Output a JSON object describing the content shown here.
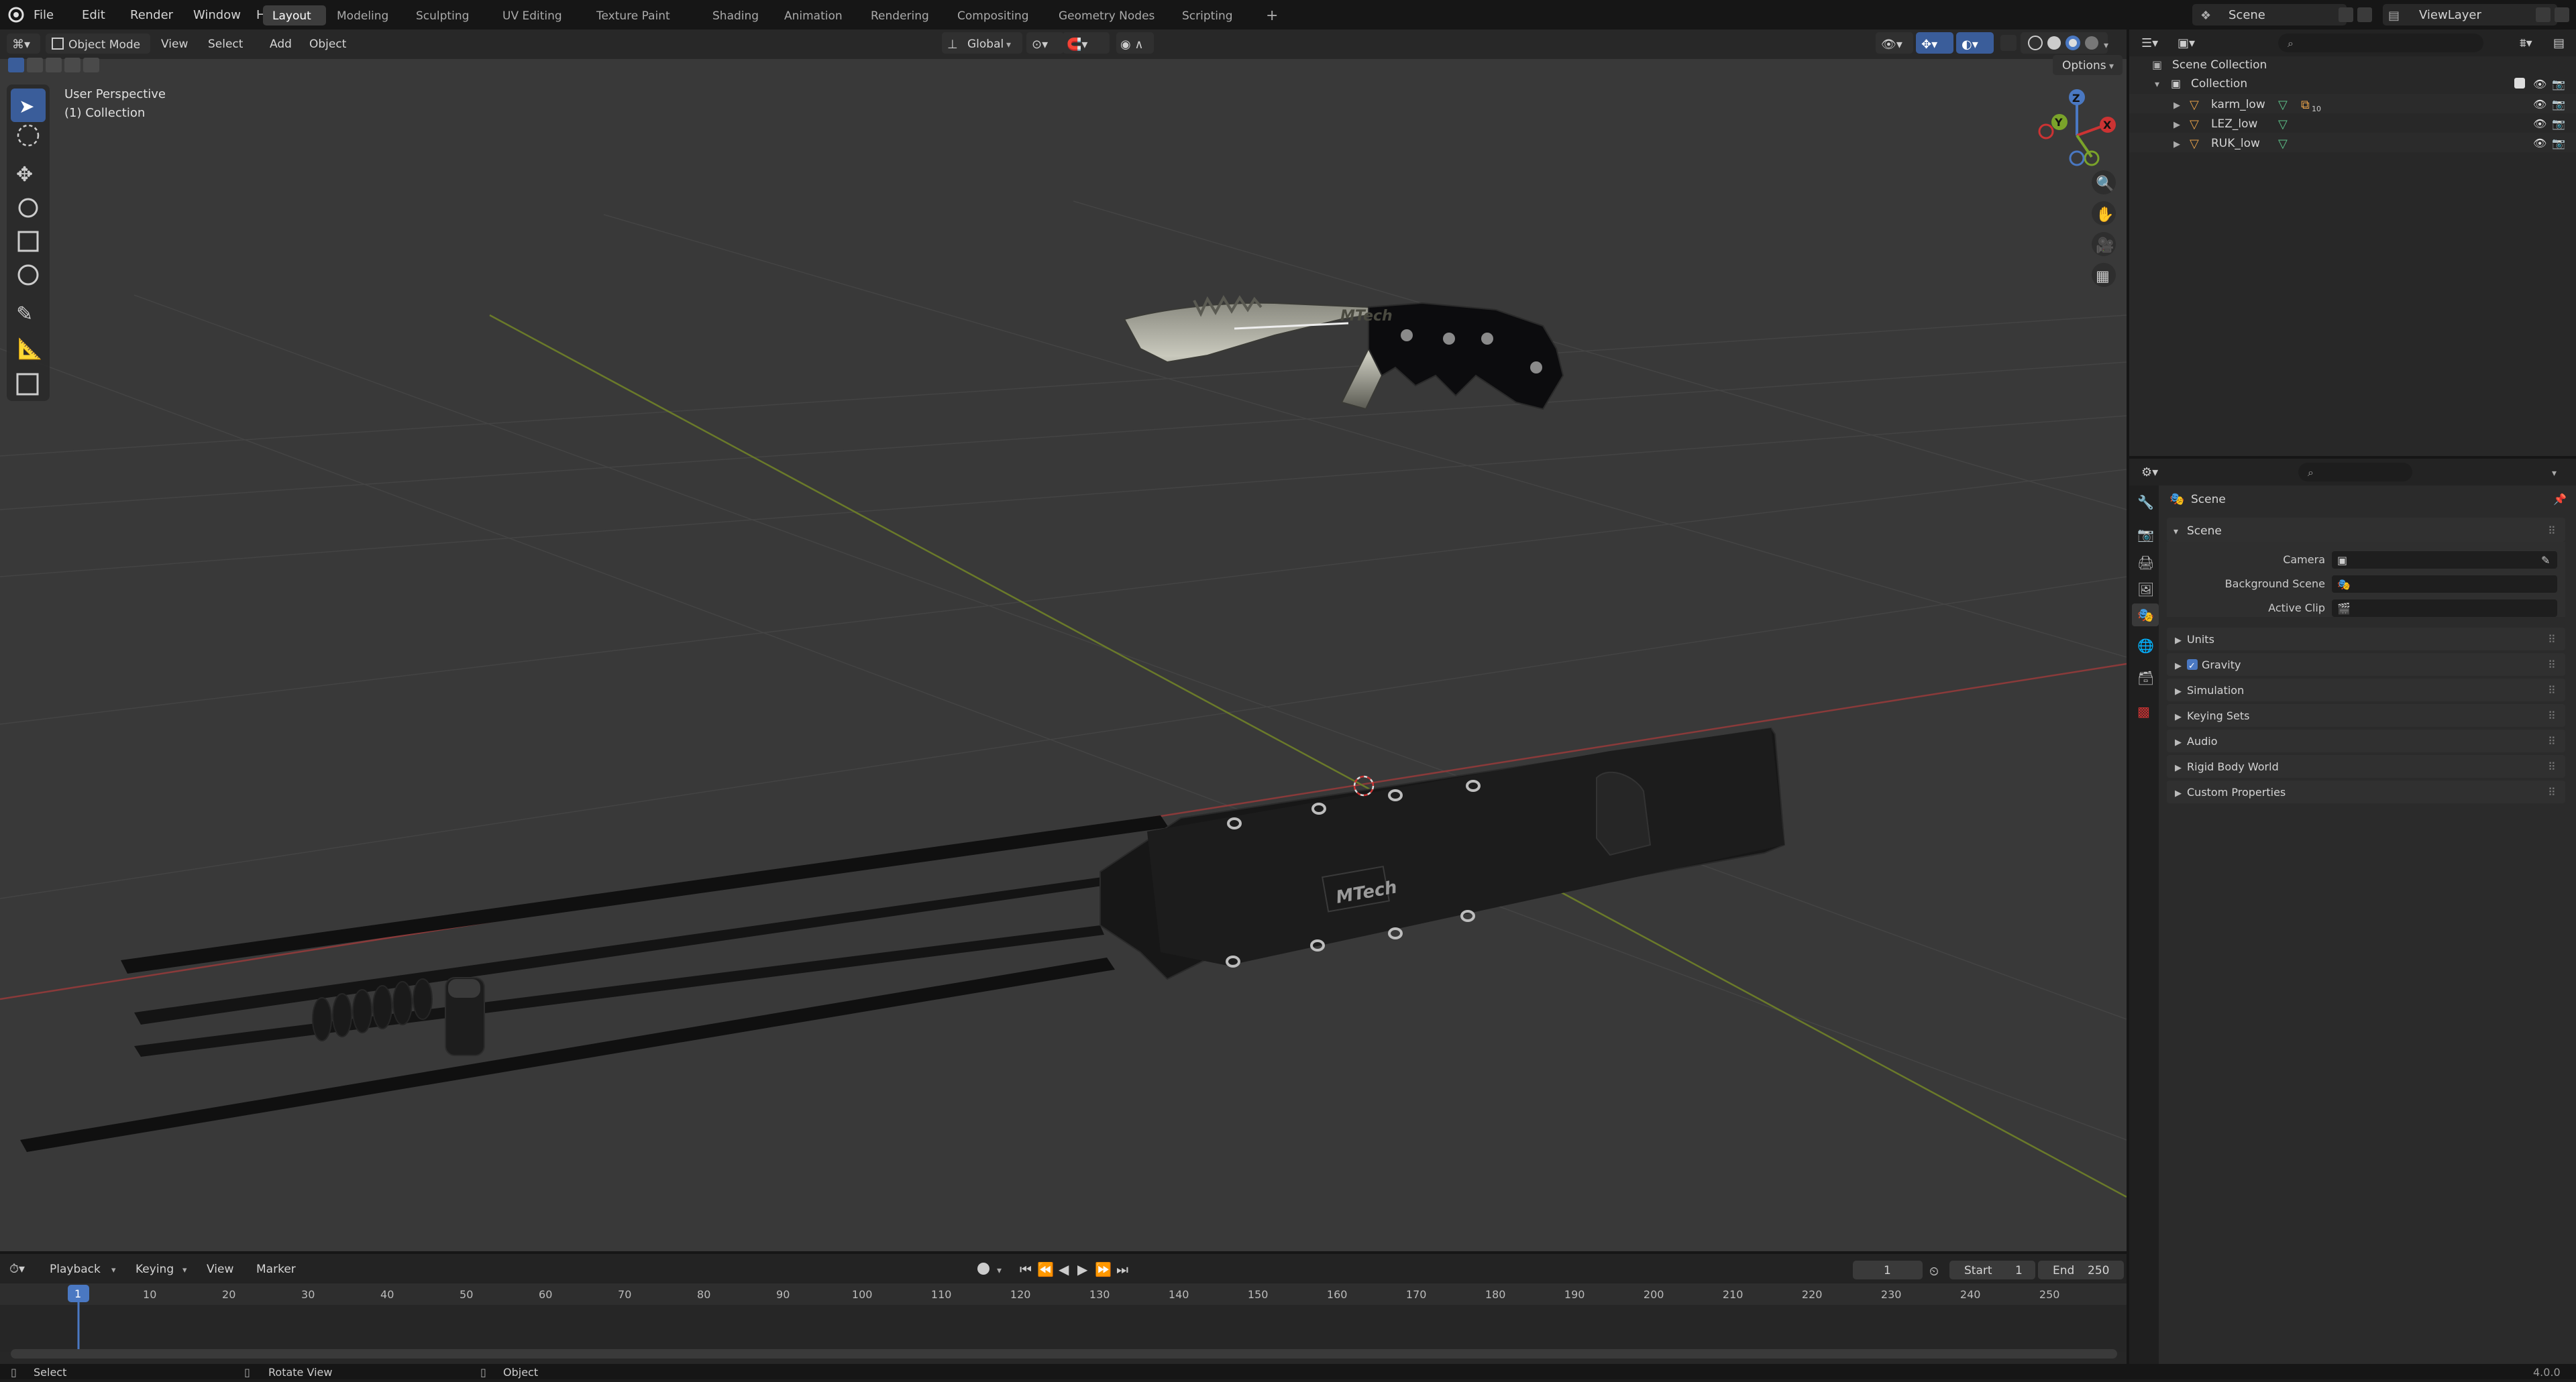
{
  "menu": {
    "items": [
      "File",
      "Edit",
      "Render",
      "Window",
      "Help"
    ],
    "workspaces": [
      "Layout",
      "Modeling",
      "Sculpting",
      "UV Editing",
      "Texture Paint",
      "Shading",
      "Animation",
      "Rendering",
      "Compositing",
      "Geometry Nodes",
      "Scripting"
    ],
    "active_workspace": "Layout",
    "add_tab": "+",
    "scene": "Scene",
    "view_layer": "ViewLayer"
  },
  "viewport": {
    "mode": "Object Mode",
    "menus": [
      "View",
      "Select",
      "Add",
      "Object"
    ],
    "transform_orientation": "Global",
    "options": "Options",
    "info_line1": "User Perspective",
    "info_line2": "(1) Collection",
    "gizmo": {
      "x": "X",
      "y": "Y",
      "z": "Z"
    },
    "logo_text": "MTech"
  },
  "outliner": {
    "root": "Scene Collection",
    "collection": "Collection",
    "objects": [
      {
        "name": "karm_low",
        "badge": "10"
      },
      {
        "name": "LEZ_low"
      },
      {
        "name": "RUK_low"
      }
    ]
  },
  "properties": {
    "context": "Scene",
    "panel": "Scene",
    "fields": [
      {
        "label": "Camera"
      },
      {
        "label": "Background Scene"
      },
      {
        "label": "Active Clip"
      }
    ],
    "sections": [
      "Units",
      "Gravity",
      "Simulation",
      "Keying Sets",
      "Audio",
      "Rigid Body World",
      "Custom Properties"
    ],
    "gravity_checked": true
  },
  "timeline": {
    "menus": [
      "Playback",
      "Keying",
      "View",
      "Marker"
    ],
    "current_frame": "1",
    "start_label": "Start",
    "start": "1",
    "end_label": "End",
    "end": "250",
    "ruler": [
      "10",
      "20",
      "30",
      "40",
      "50",
      "60",
      "70",
      "80",
      "90",
      "100",
      "110",
      "120",
      "130",
      "140",
      "150",
      "160",
      "170",
      "180",
      "190",
      "200",
      "210",
      "220",
      "230",
      "240",
      "250"
    ]
  },
  "status": {
    "select": "Select",
    "rotate": "Rotate View",
    "object": "Object",
    "version": "4.0.0"
  }
}
